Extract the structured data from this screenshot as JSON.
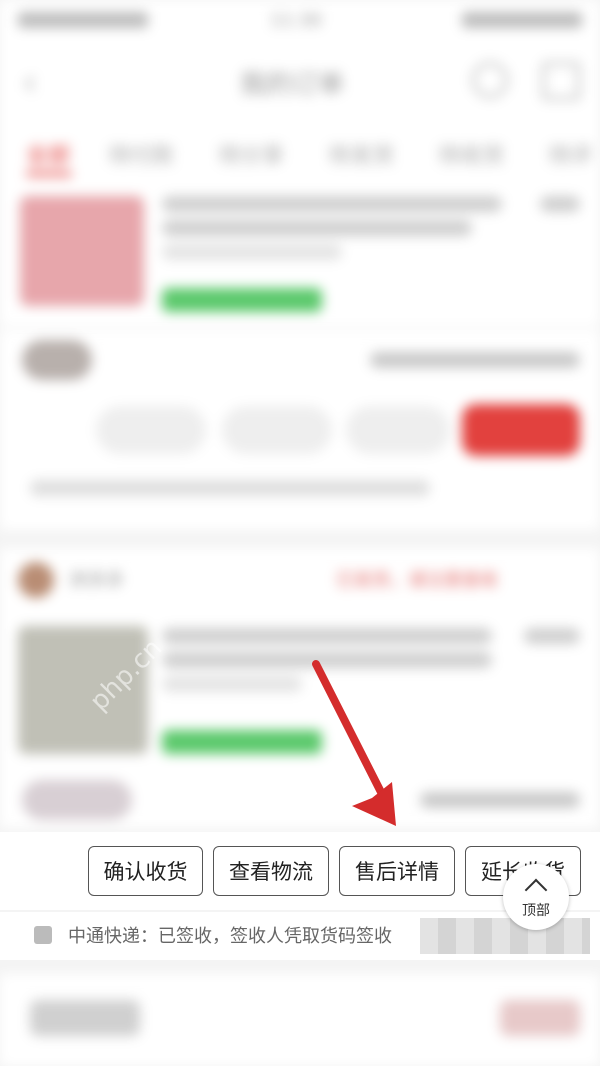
{
  "status_bar": {
    "time": "11:30"
  },
  "nav": {
    "title": "我的订单"
  },
  "tabs": [
    "全部",
    "待付款",
    "待分享",
    "待发货",
    "待收货",
    "待评"
  ],
  "orders": [
    {
      "status": "",
      "tag": ""
    },
    {
      "shop": "",
      "status": ""
    },
    {
      "shop": "拼多多",
      "status": "已发货，请注意查收"
    }
  ],
  "watermark": "php.cn",
  "action_bar": {
    "buttons": [
      "确认收货",
      "查看物流",
      "售后详情",
      "延长收货"
    ]
  },
  "top_button": {
    "label": "顶部"
  },
  "logistics": {
    "text": "中通快递：已签收，签收人凭取货码签收"
  },
  "colors": {
    "accent": "#e2413e",
    "tag_green": "#5cc96c",
    "arrow": "#d42c2c"
  }
}
